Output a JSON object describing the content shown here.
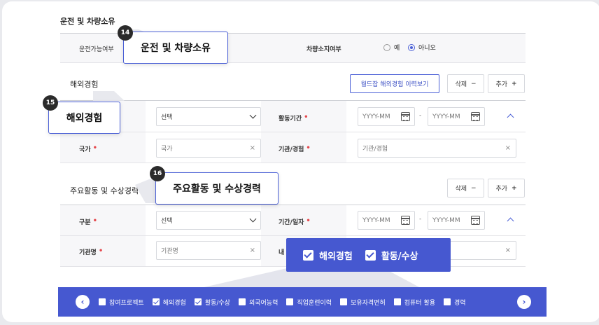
{
  "driving": {
    "section_title": "운전 및 차량소유",
    "driving_label": "운전가능여부",
    "car_label": "차량소지여부",
    "options": [
      "예",
      "아니오"
    ],
    "callout_number": "14",
    "callout_text": "운전 및 차량소유"
  },
  "overseas": {
    "section_title": "해외경험",
    "view_button": "월드잡 해외경험 이력보기",
    "delete_button": "삭제",
    "add_button": "추가",
    "select_value": "선택",
    "period_label": "활동기간",
    "date_placeholder": "YYYY-MM",
    "dash": "-",
    "country_label": "국가",
    "country_placeholder": "국가",
    "org_label": "기관/경험",
    "org_placeholder": "기관/경험",
    "callout_number": "15",
    "callout_text": "해외경험"
  },
  "activity": {
    "section_title": "주요활동 및 수상경력",
    "delete_button": "삭제",
    "add_button": "추가",
    "type_label": "구분",
    "select_value": "선택",
    "period_label": "기간/일자",
    "date_placeholder": "YYYY-MM",
    "dash": "-",
    "org_label": "기관명",
    "org_placeholder": "기관명",
    "content_label_partial": "내",
    "callout_number": "16",
    "callout_text": "주요활동 및 수상경력"
  },
  "popup": {
    "items": [
      "해외경험",
      "활동/수상"
    ]
  },
  "bottom_bar": {
    "items": [
      {
        "label": "참여프로젝트",
        "checked": false
      },
      {
        "label": "해외경험",
        "checked": true
      },
      {
        "label": "활동/수상",
        "checked": true
      },
      {
        "label": "외국어능력",
        "checked": false
      },
      {
        "label": "직업훈련이력",
        "checked": false
      },
      {
        "label": "보유자격면허",
        "checked": false
      },
      {
        "label": "컴퓨터 활용",
        "checked": false
      },
      {
        "label": "경력",
        "checked": false
      }
    ],
    "prev": "‹",
    "next": "›"
  },
  "colors": {
    "accent": "#4658d0",
    "required": "#e5484d"
  },
  "plus_symbol": "+",
  "minus_symbol": "−",
  "clear_symbol": "×"
}
